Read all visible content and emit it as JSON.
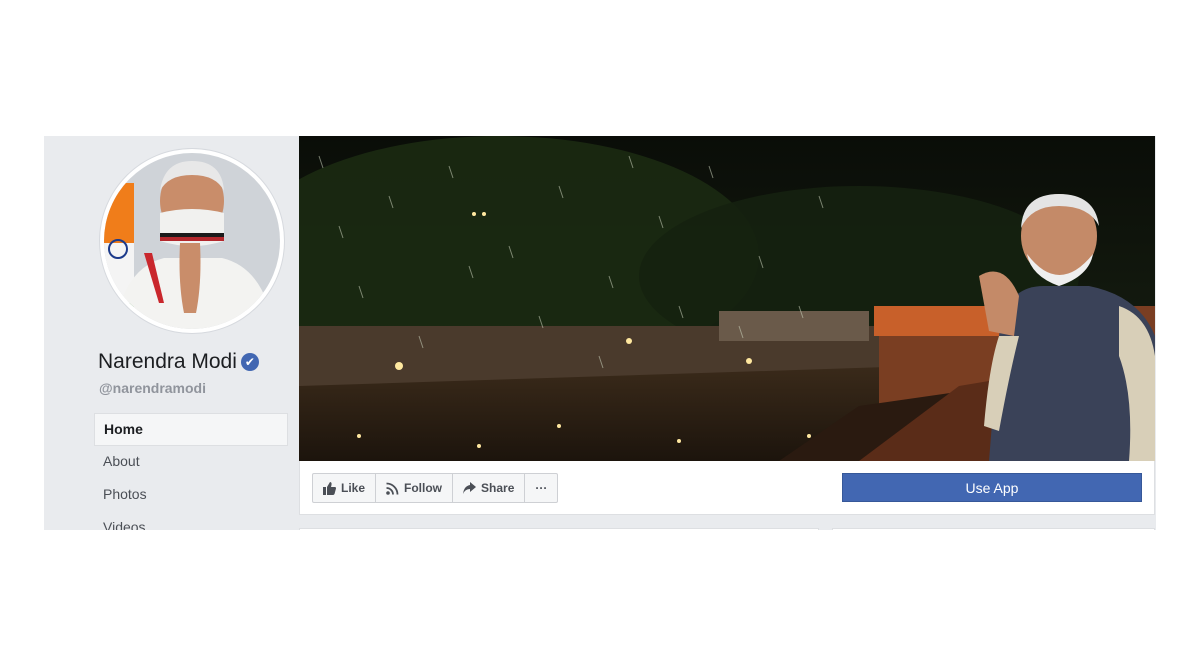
{
  "profile": {
    "name": "Narendra Modi",
    "verified_icon": "✔",
    "handle": "@narendramodi"
  },
  "nav": {
    "items": [
      {
        "label": "Home",
        "active": true
      },
      {
        "label": "About",
        "active": false
      },
      {
        "label": "Photos",
        "active": false
      },
      {
        "label": "Videos",
        "active": false
      }
    ]
  },
  "actions": {
    "like": "Like",
    "follow": "Follow",
    "share": "Share",
    "more": "···",
    "use_app": "Use App"
  },
  "colors": {
    "brand_blue": "#4267b2",
    "page_bg": "#e9ebee"
  }
}
